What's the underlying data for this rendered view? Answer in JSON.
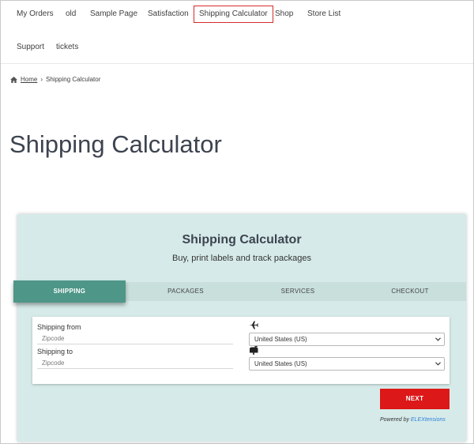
{
  "nav": {
    "items": [
      "My Orders",
      "old",
      "Sample Page",
      "Satisfaction",
      "Shipping Calculator",
      "Shop",
      "Store List",
      "Support",
      "tickets"
    ],
    "active": "Shipping Calculator"
  },
  "breadcrumb": {
    "home": "Home",
    "separator": "›",
    "current": "Shipping Calculator"
  },
  "page": {
    "title": "Shipping Calculator"
  },
  "calculator": {
    "title": "Shipping Calculator",
    "subtitle": "Buy, print labels and track packages",
    "tabs": [
      "SHIPPING",
      "PACKAGES",
      "SERVICES",
      "CHECKOUT"
    ],
    "active_tab": "SHIPPING",
    "from_label": "Shipping from",
    "from_placeholder": "Zipcode",
    "to_label": "Shipping to",
    "to_placeholder": "Zipcode",
    "from_country": "United States (US)",
    "to_country": "United States (US)",
    "from_icon": "airplane-icon",
    "to_icon": "mailbox-icon",
    "next_label": "NEXT",
    "powered_prefix": "Powered by",
    "powered_brand": "ELEXtensions"
  },
  "colors": {
    "accent_tab": "#4e9688",
    "next_button": "#dc1818",
    "card_bg": "#d6ebe9",
    "nav_active_border": "#d62b2b"
  }
}
